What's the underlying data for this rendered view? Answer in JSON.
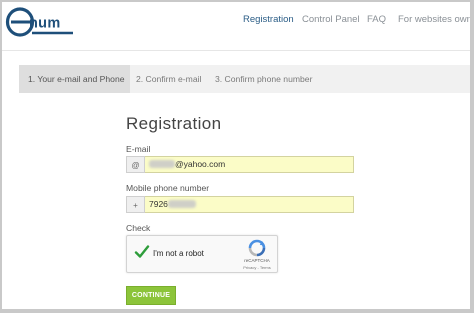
{
  "brand": {
    "logo_text": "enum"
  },
  "nav": {
    "items": [
      {
        "label": "Registration"
      },
      {
        "label": "Control Panel"
      },
      {
        "label": "FAQ"
      },
      {
        "label": "For websites owners"
      }
    ]
  },
  "steps": [
    {
      "label": "1. Your e-mail and Phone"
    },
    {
      "label": "2. Confirm e-mail"
    },
    {
      "label": "3. Confirm phone number"
    }
  ],
  "form": {
    "title": "Registration",
    "email": {
      "label": "E-mail",
      "addon": "@",
      "value_visible": "@yahoo.com"
    },
    "phone": {
      "label": "Mobile phone number",
      "addon": "+",
      "value_visible": "7926"
    },
    "check": {
      "label": "Check"
    },
    "recaptcha": {
      "text": "I'm not a robot",
      "brand": "reCAPTCHA",
      "links": "Privacy - Terms"
    },
    "submit_label": "CONTINUE"
  },
  "colors": {
    "accent_nav_active": "#2b5d86",
    "input_bg": "#fbfcc7",
    "button_green": "#8cc43a",
    "checkmark_green": "#2e9d3b"
  }
}
